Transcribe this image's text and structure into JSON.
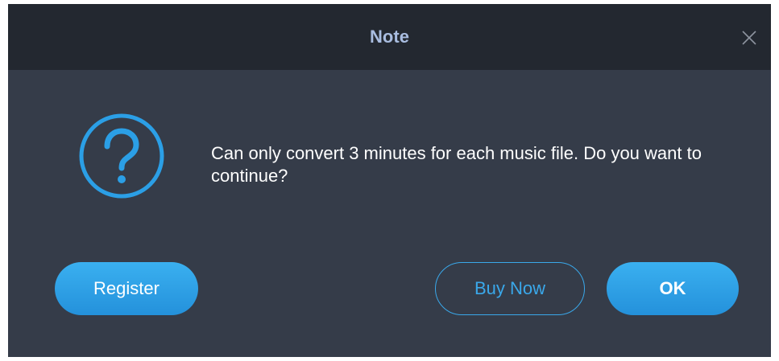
{
  "dialog": {
    "title": "Note",
    "close_icon": "close-icon",
    "question_icon": "question-mark-circle-icon",
    "message": "Can only convert 3 minutes for each music file. Do you want to continue?",
    "buttons": {
      "register": "Register",
      "buy_now": "Buy Now",
      "ok": "OK"
    }
  },
  "colors": {
    "titlebar": "#232830",
    "body": "#353c49",
    "accent": "#2b9fe6",
    "title_text": "#a9bde0"
  }
}
